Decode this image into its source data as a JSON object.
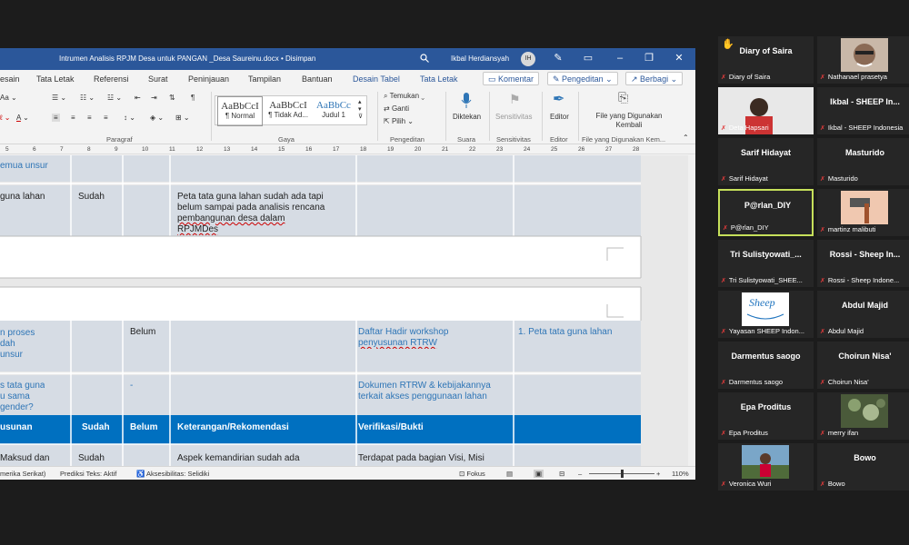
{
  "window": {
    "title": "Intrumen Analisis RPJM Desa untuk PANGAN _Desa Saureinu.docx  •  Disimpan",
    "user": "Ikbal Herdiansyah",
    "avatar_initials": "IH"
  },
  "tabs": [
    "esain",
    "Tata Letak",
    "Referensi",
    "Surat",
    "Peninjauan",
    "Tampilan",
    "Bantuan",
    "Desain Tabel",
    "Tata Letak"
  ],
  "tab_actions": {
    "comment": "Komentar",
    "editing": "Pengeditan",
    "share": "Berbagi"
  },
  "ribbon": {
    "groups": [
      "Paragraf",
      "Gaya",
      "Pengeditan",
      "Suara",
      "Sensitivitas",
      "Editor",
      "File yang Digunakan Kem..."
    ],
    "styles": [
      {
        "preview": "AaBbCcI",
        "name": "¶ Normal"
      },
      {
        "preview": "AaBbCcI",
        "name": "¶ Tidak Ad..."
      },
      {
        "preview": "AaBbCc",
        "name": "Judul 1"
      }
    ],
    "find": "Temukan",
    "replace": "Ganti",
    "select": "Pilih",
    "dictate": "Diktekan",
    "sensitivity": "Sensitivitas",
    "editor": "Editor",
    "reuse_files": "File yang Digunakan Kembali"
  },
  "ruler_ticks": [
    "5",
    "6",
    "7",
    "8",
    "9",
    "10",
    "11",
    "12",
    "13",
    "14",
    "15",
    "16",
    "17",
    "18",
    "19",
    "20",
    "21",
    "22",
    "23",
    "24",
    "25",
    "26",
    "27",
    "28"
  ],
  "table": {
    "row1_col1": "emua unsur",
    "row2": {
      "col1": "guna lahan",
      "col2": "Sudah",
      "col4_lines": [
        "Peta tata guna lahan sudah ada tapi",
        "belum sampai pada analisis rencana",
        "pembangunan desa dalam",
        "RPJMDes"
      ]
    },
    "row3": {
      "col1_lines": [
        "n proses",
        "dah",
        "unsur"
      ],
      "col3": "Belum",
      "col5_lines": [
        "Daftar Hadir workshop",
        "penyusunan RTRW"
      ],
      "col6": "1.   Peta tata guna lahan"
    },
    "row4": {
      "col1_lines": [
        "s tata guna",
        "u sama",
        "gender?"
      ],
      "col3": "-",
      "col5_lines": [
        "Dokumen RTRW & kebijakannya",
        "terkait akses penggunaan lahan"
      ]
    },
    "header": [
      "usunan",
      "Sudah",
      "Belum",
      "Keterangan/Rekomendasi",
      "Verifikasi/Bukti"
    ],
    "row5": {
      "col1": "Maksud dan",
      "col2": "Sudah",
      "col4": "Aspek kemandirian sudah ada",
      "col5": "Terdapat pada bagian Visi, Misi"
    }
  },
  "status": {
    "lang": "merika Serikat)",
    "predict": "Prediksi Teks: Aktif",
    "access": "Aksesibilitas: Selidiki",
    "focus": "Fokus",
    "zoom": "110%"
  },
  "participants": [
    {
      "name": "Diary of Saira",
      "label": "Diary of Saira",
      "type": "name",
      "hand": "✋"
    },
    {
      "name": "",
      "label": "Nathanael prasetya",
      "type": "photo",
      "photo": "face"
    },
    {
      "name": "",
      "label": "Deta Hapsari",
      "type": "photo",
      "photo": "person"
    },
    {
      "name": "Ikbal - SHEEP In...",
      "label": "Ikbal - SHEEP Indonesia",
      "type": "name"
    },
    {
      "name": "Sarif Hidayat",
      "label": "Sarif Hidayat",
      "type": "name"
    },
    {
      "name": "Masturido",
      "label": "Masturido",
      "type": "name"
    },
    {
      "name": "P@rlan_DIY",
      "label": "P@rlan_DIY",
      "type": "name",
      "active": true
    },
    {
      "name": "",
      "label": "martinz malibuti",
      "type": "photo",
      "photo": "hammer"
    },
    {
      "name": "Tri  Sulistyowati_...",
      "label": "Tri Sulistyowati_SHEE...",
      "type": "name"
    },
    {
      "name": "Rossi - Sheep In...",
      "label": "Rossi - Sheep Indone...",
      "type": "name"
    },
    {
      "name": "",
      "label": "Yayasan SHEEP Indon...",
      "type": "photo",
      "photo": "logo",
      "logo_text": "Sheep"
    },
    {
      "name": "Abdul Majid",
      "label": "Abdul Majid",
      "type": "name"
    },
    {
      "name": "Darmentus saogo",
      "label": "Darmentus saogo",
      "type": "name"
    },
    {
      "name": "Choirun Nisa'",
      "label": "Choirun Nisa'",
      "type": "name"
    },
    {
      "name": "Epa Proditus",
      "label": "Epa Proditus",
      "type": "name"
    },
    {
      "name": "",
      "label": "merry ifan",
      "type": "photo",
      "photo": "moss"
    },
    {
      "name": "",
      "label": "Veronica Wuri",
      "type": "photo",
      "photo": "outdoor"
    },
    {
      "name": "Bowo",
      "label": "Bowo",
      "type": "name"
    }
  ]
}
